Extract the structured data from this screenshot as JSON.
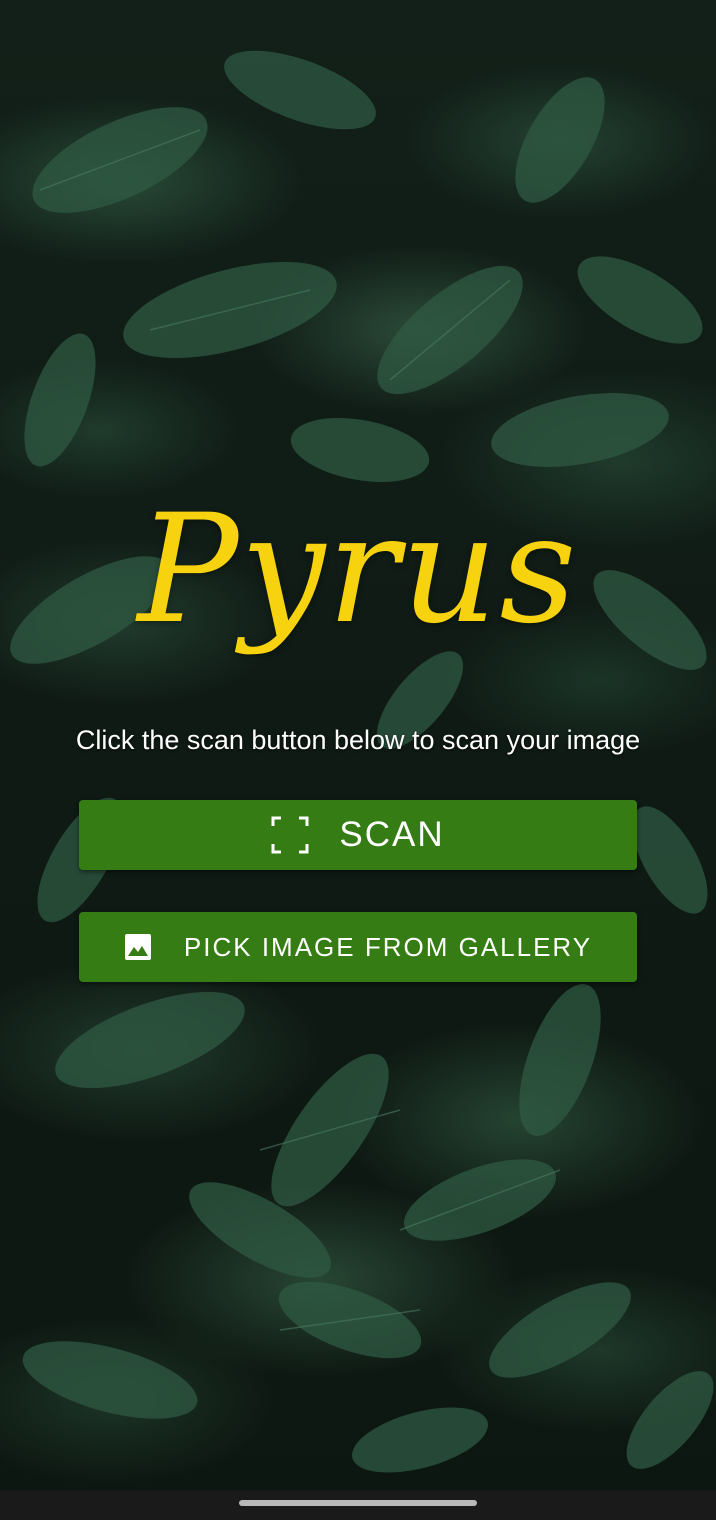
{
  "app": {
    "title": "Pyrus",
    "instruction": "Click the scan button below to scan your image"
  },
  "buttons": {
    "scan_label": "SCAN",
    "gallery_label": "PICK IMAGE FROM GALLERY"
  },
  "icons": {
    "scan": "scan-frame-icon",
    "gallery": "image-icon"
  },
  "colors": {
    "title": "#f7d20f",
    "button": "#367c14",
    "text": "#ffffff"
  }
}
